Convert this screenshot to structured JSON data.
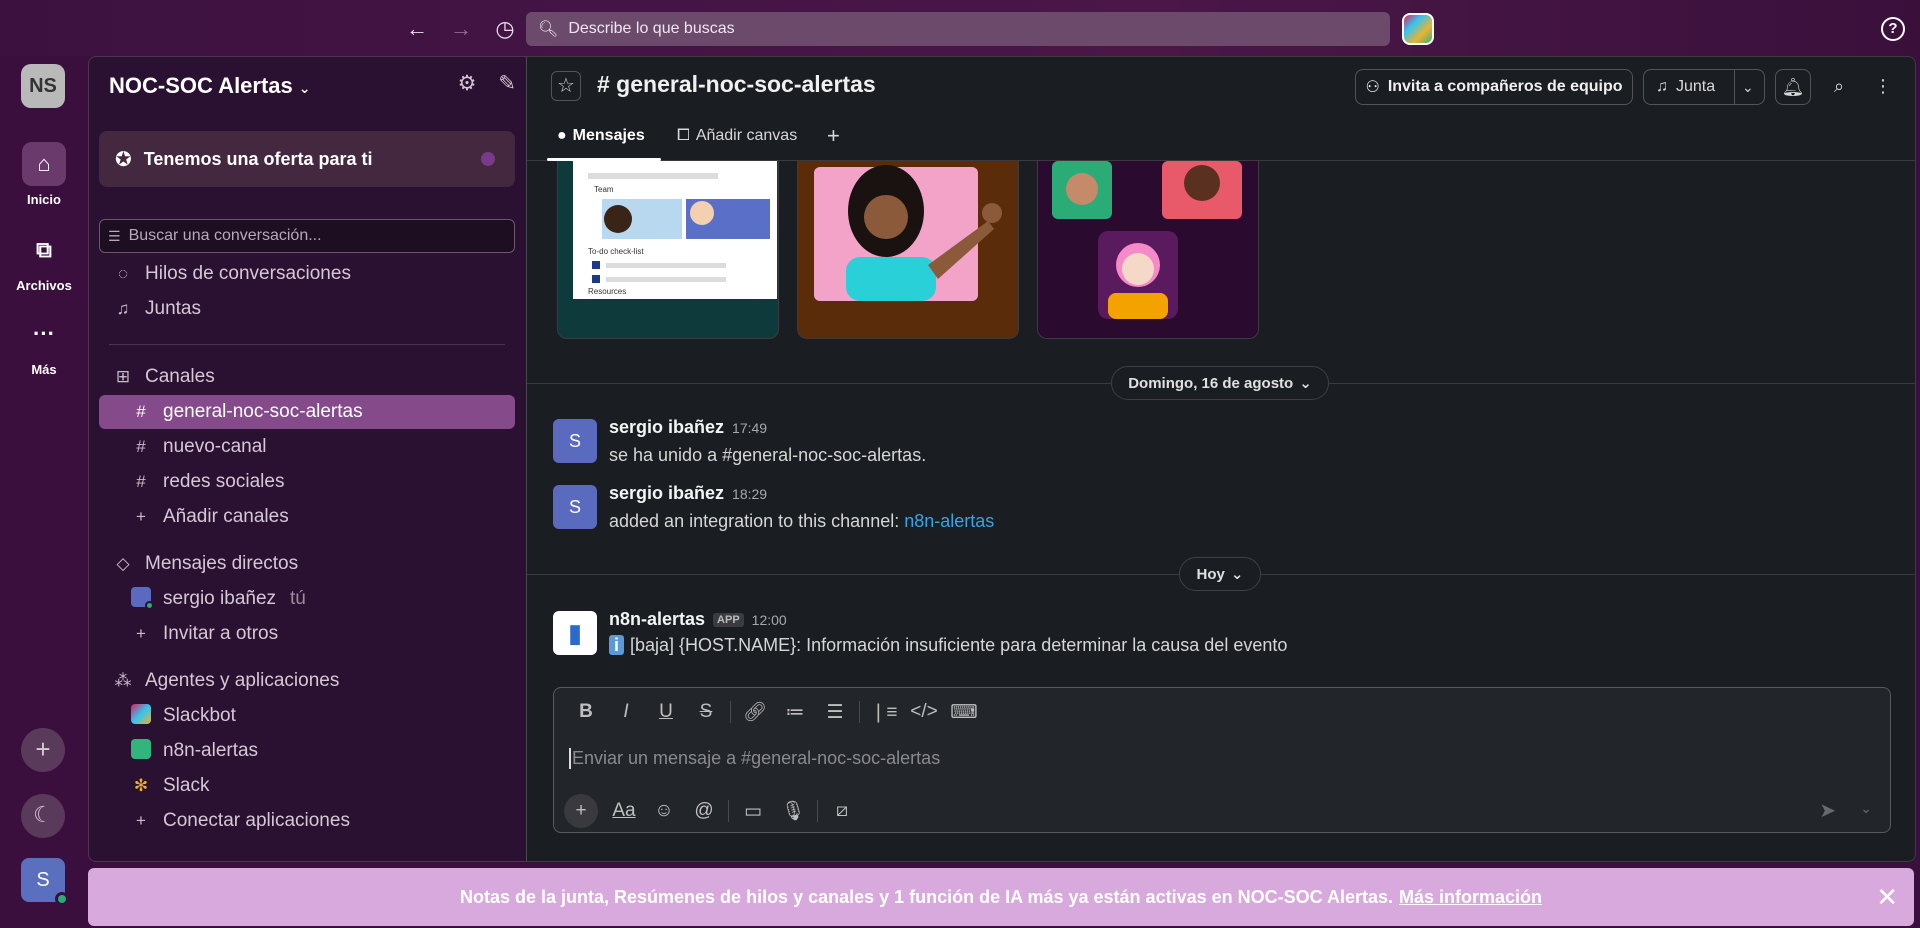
{
  "topbar": {
    "search_placeholder": "Describe lo que buscas",
    "help_label": "?"
  },
  "rail": {
    "workspace_initials": "NS",
    "items": [
      {
        "label": "Inicio",
        "icon": "home-icon"
      },
      {
        "label": "Archivos",
        "icon": "files-icon"
      },
      {
        "label": "Más",
        "icon": "more-icon"
      }
    ],
    "add_label": "+",
    "user_initial": "S"
  },
  "sidebar": {
    "workspace_name": "NOC-SOC Alertas",
    "promo": "Tenemos una oferta para ti",
    "search_placeholder": "Buscar una conversación...",
    "threads": "Hilos de conversaciones",
    "huddles": "Juntas",
    "channels_header": "Canales",
    "channels": [
      "general-noc-soc-alertas",
      "nuevo-canal",
      "redes sociales"
    ],
    "add_channels": "Añadir canales",
    "dms_header": "Mensajes directos",
    "dm_user": "sergio ibañez",
    "dm_you": "tú",
    "invite": "Invitar a otros",
    "apps_header": "Agentes y aplicaciones",
    "apps": [
      "Slackbot",
      "n8n-alertas",
      "Slack"
    ],
    "connect_apps": "Conectar aplicaciones"
  },
  "channel": {
    "title": "# general-noc-soc-alertas",
    "invite_button": "Invita a compañeros de equipo",
    "huddle_button": "Junta",
    "tabs": {
      "messages": "Mensajes",
      "canvas": "Añadir canvas"
    },
    "card1": {
      "team": "Team",
      "todo": "To-do check-list",
      "resources": "Resources"
    }
  },
  "messages": {
    "date1": "Domingo, 16 de agosto",
    "m1": {
      "author": "sergio ibañez",
      "time": "17:49",
      "text": "se ha unido a #general-noc-soc-alertas.",
      "avatar": "S"
    },
    "m2": {
      "author": "sergio ibañez",
      "time": "18:29",
      "text": "added an integration to this channel: ",
      "link": "n8n-alertas",
      "avatar": "S"
    },
    "date2": "Hoy",
    "m3": {
      "author": "n8n-alertas",
      "badge": "APP",
      "time": "12:00",
      "text": "[baja] {HOST.NAME}: Información insuficiente para determinar la causa del evento"
    }
  },
  "composer": {
    "placeholder": "Enviar un mensaje a #general-noc-soc-alertas"
  },
  "banner": {
    "text": "Notas de la junta, Resúmenes de hilos y canales y 1 función de IA más ya están activas en NOC-SOC Alertas.",
    "link": "Más información"
  },
  "colors": {
    "aubergine": "#3b0f3d",
    "sidebar_bg": "#2b1131",
    "active_channel": "#844a8a",
    "main_bg": "#1a1d21",
    "link": "#3aa3e3",
    "banner_bg": "#d8a9dc",
    "online": "#2bac76"
  }
}
